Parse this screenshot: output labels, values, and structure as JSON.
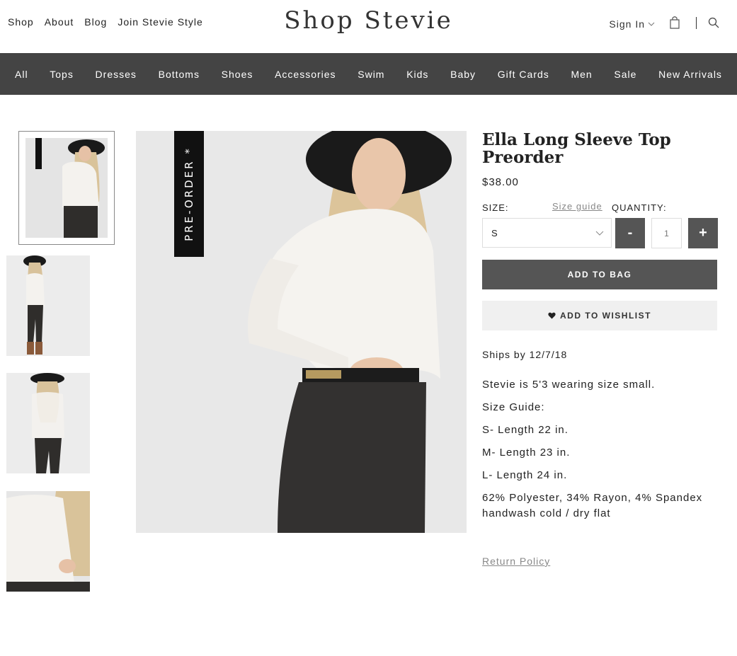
{
  "header": {
    "top_links": [
      "Shop",
      "About",
      "Blog",
      "Join Stevie Style"
    ],
    "logo": "Shop Stevie",
    "sign_in": "Sign In"
  },
  "categories": [
    "All",
    "Tops",
    "Dresses",
    "Bottoms",
    "Shoes",
    "Accessories",
    "Swim",
    "Kids",
    "Baby",
    "Gift Cards",
    "Men",
    "Sale",
    "New Arrivals"
  ],
  "gallery": {
    "badge": "PRE-ORDER *",
    "thumbnails": [
      "front-view",
      "full-body",
      "back-view",
      "sleeve-detail"
    ]
  },
  "product": {
    "title": "Ella Long Sleeve Top Preorder",
    "price": "$38.00",
    "size_label": "SIZE:",
    "size_guide_link": "Size guide",
    "quantity_label": "QUANTITY:",
    "size_selected": "S",
    "quantity": "1",
    "minus": "-",
    "plus": "+",
    "add_to_bag": "ADD TO BAG",
    "add_to_wishlist": "ADD TO WISHLIST",
    "ships": "Ships by 12/7/18",
    "description": [
      "Stevie is 5'3 wearing size small.",
      "Size Guide:",
      "S- Length 22 in.",
      "M- Length 23 in.",
      "L- Length 24 in.",
      "62% Polyester, 34% Rayon, 4% Spandex handwash cold / dry flat"
    ],
    "return_policy": "Return Policy"
  },
  "colors": {
    "nav_bg": "#444444",
    "button_bg": "#555555",
    "wishlist_bg": "#f0f0f0"
  }
}
